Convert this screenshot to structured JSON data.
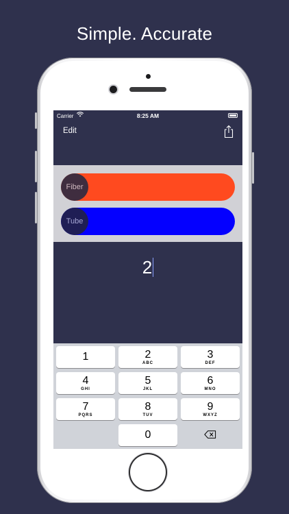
{
  "headline": "Simple. Accurate",
  "status_bar": {
    "carrier": "Carrier",
    "time": "8:25 AM"
  },
  "navbar": {
    "edit_label": "Edit"
  },
  "selectors": [
    {
      "label": "Fiber",
      "color": "#ff4a1f"
    },
    {
      "label": "Tube",
      "color": "#0400ff"
    }
  ],
  "input": {
    "value": "2"
  },
  "keypad": {
    "rows": [
      [
        {
          "num": "1",
          "letters": ""
        },
        {
          "num": "2",
          "letters": "ABC"
        },
        {
          "num": "3",
          "letters": "DEF"
        }
      ],
      [
        {
          "num": "4",
          "letters": "GHI"
        },
        {
          "num": "5",
          "letters": "JKL"
        },
        {
          "num": "6",
          "letters": "MNO"
        }
      ],
      [
        {
          "num": "7",
          "letters": "PQRS"
        },
        {
          "num": "8",
          "letters": "TUV"
        },
        {
          "num": "9",
          "letters": "WXYZ"
        }
      ],
      [
        {
          "num": "0",
          "letters": ""
        }
      ]
    ],
    "delete_icon": "backspace-icon"
  },
  "colors": {
    "background": "#2f314d",
    "keypad": "#d0d3d9"
  }
}
